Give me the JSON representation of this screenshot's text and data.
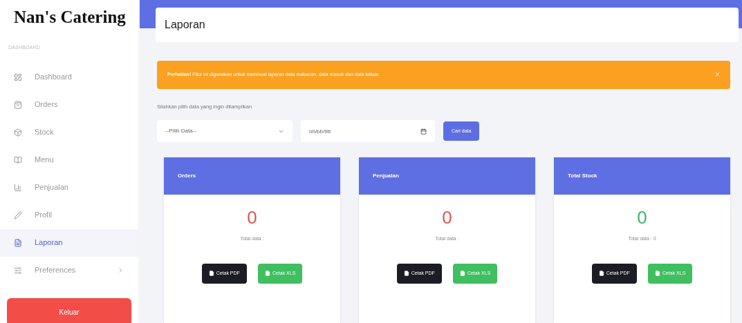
{
  "sidebar": {
    "brand": "Nan's Catering",
    "section_label": "DASHBOARD",
    "items": [
      {
        "label": "Dashboard",
        "selected": false,
        "expandable": false
      },
      {
        "label": "Orders",
        "selected": false,
        "expandable": false
      },
      {
        "label": "Stock",
        "selected": false,
        "expandable": false
      },
      {
        "label": "Menu",
        "selected": false,
        "expandable": false
      },
      {
        "label": "Penjualan",
        "selected": false,
        "expandable": false
      },
      {
        "label": "Profil",
        "selected": false,
        "expandable": false
      },
      {
        "label": "Laporan",
        "selected": true,
        "expandable": false
      },
      {
        "label": "Preferences",
        "selected": false,
        "expandable": true
      }
    ],
    "logout": "Keluar"
  },
  "page_title": "Laporan",
  "alert": {
    "text": "**Perhatian!** Fitur ini digunakan untuk membuat laporan data makanan, data masuk dan data keluar.",
    "close": "×"
  },
  "filter": {
    "label": "Silahkan pilih data yang ingin ditampilkan",
    "select_placeholder": "--Pilih Data--",
    "date_placeholder": "hh/bb/tttt",
    "button": "Cari data"
  },
  "cards": [
    {
      "title": "Orders",
      "value": "0",
      "color": "#e0564f",
      "caption": "Total data :",
      "buttons": [
        {
          "label": "Cetak PDF",
          "kind": "pdf"
        },
        {
          "label": "Cetak XLS",
          "kind": "xls"
        }
      ]
    },
    {
      "title": "Penjualan",
      "value": "0",
      "color": "#e0564f",
      "caption": "Total data :",
      "buttons": [
        {
          "label": "Cetak PDF",
          "kind": "pdf"
        },
        {
          "label": "Cetak XLS",
          "kind": "xls"
        }
      ]
    },
    {
      "title": "Total Stock",
      "value": "0",
      "color": "#3cb56a",
      "caption": "Total data : 0",
      "buttons": [
        {
          "label": "Cetak PDF",
          "kind": "pdf"
        },
        {
          "label": "Cetak XLS",
          "kind": "xls"
        }
      ]
    }
  ]
}
